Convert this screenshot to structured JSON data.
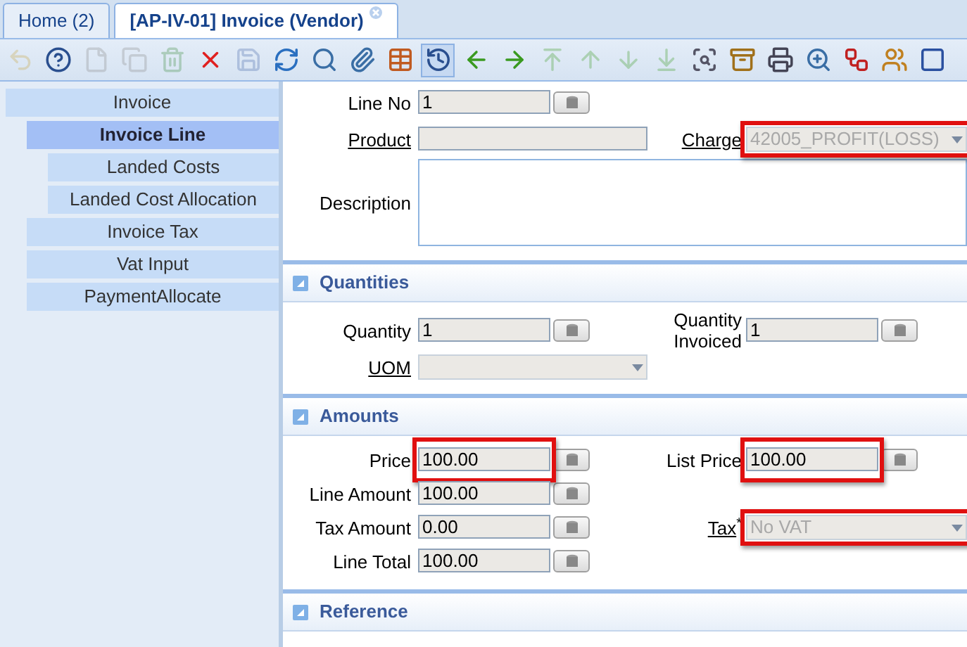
{
  "tabs": [
    {
      "label": "Home (2)",
      "selected": false,
      "closable": false
    },
    {
      "label": "[AP-IV-01] Invoice (Vendor)",
      "selected": true,
      "closable": true
    }
  ],
  "toolbar": [
    {
      "disabled": true,
      "pressed": false
    },
    {
      "disabled": false,
      "pressed": false
    },
    {
      "disabled": true,
      "pressed": false
    },
    {
      "disabled": true,
      "pressed": false
    },
    {
      "disabled": true,
      "pressed": false
    },
    {
      "disabled": false,
      "pressed": false
    },
    {
      "disabled": true,
      "pressed": false
    },
    {
      "disabled": false,
      "pressed": false
    },
    {
      "disabled": false,
      "pressed": false
    },
    {
      "disabled": false,
      "pressed": false
    },
    {
      "disabled": false,
      "pressed": false
    },
    {
      "disabled": false,
      "pressed": true
    },
    {
      "disabled": false,
      "pressed": false
    },
    {
      "disabled": false,
      "pressed": false
    },
    {
      "disabled": true,
      "pressed": false
    },
    {
      "disabled": true,
      "pressed": false
    },
    {
      "disabled": true,
      "pressed": false
    },
    {
      "disabled": true,
      "pressed": false
    },
    {
      "disabled": false,
      "pressed": false
    },
    {
      "disabled": false,
      "pressed": false
    },
    {
      "disabled": false,
      "pressed": false
    },
    {
      "disabled": false,
      "pressed": false
    },
    {
      "disabled": false,
      "pressed": false
    },
    {
      "disabled": false,
      "pressed": false
    },
    {
      "disabled": false,
      "pressed": false
    }
  ],
  "sidebar": {
    "items": [
      {
        "label": "Invoice",
        "selected": false,
        "children": [
          {
            "label": "Invoice Line",
            "selected": true,
            "children": [
              {
                "label": "Landed Costs",
                "selected": false
              },
              {
                "label": "Landed Cost Allocation",
                "selected": false
              }
            ]
          },
          {
            "label": "Invoice Tax",
            "selected": false
          },
          {
            "label": "Vat Input",
            "selected": false
          },
          {
            "label": "PaymentAllocate",
            "selected": false
          }
        ]
      }
    ]
  },
  "header_rows": [
    {
      "left": {
        "label": "Line No",
        "kind": "number",
        "value": "1",
        "link": false
      }
    },
    {
      "left": {
        "label": "Product",
        "kind": "text",
        "link": true
      },
      "right": {
        "label": "Charge",
        "kind": "combo",
        "value": "42005_PROFIT(LOSS)",
        "link": true,
        "highlighted": true,
        "dimmed": true
      }
    },
    {
      "full": {
        "label": "Description",
        "kind": "textarea",
        "link": false
      }
    }
  ],
  "sections": [
    {
      "title": "Quantities",
      "expanded": true,
      "rows": [
        {
          "left": {
            "label": "Quantity",
            "kind": "number",
            "value": "1",
            "link": false
          },
          "right": {
            "label": "Quantity Invoiced",
            "kind": "number",
            "value": "1",
            "link": false
          }
        },
        {
          "left": {
            "label": "UOM",
            "kind": "combo",
            "link": true
          }
        }
      ]
    },
    {
      "title": "Amounts",
      "expanded": true,
      "rows": [
        {
          "left": {
            "label": "Price",
            "kind": "number",
            "value": "100.00",
            "link": false,
            "highlighted": true
          },
          "right": {
            "label": "List Price",
            "kind": "number",
            "value": "100.00",
            "link": false,
            "highlighted": true
          }
        },
        {
          "left": {
            "label": "Line Amount",
            "kind": "number",
            "value": "100.00",
            "link": false
          }
        },
        {
          "left": {
            "label": "Tax Amount",
            "kind": "number",
            "value": "0.00",
            "link": false
          },
          "right": {
            "label": "Tax",
            "required_mark": "*",
            "kind": "combo",
            "value": "No VAT",
            "link": true,
            "highlighted": true,
            "dimmed": true
          }
        },
        {
          "left": {
            "label": "Line Total",
            "kind": "number",
            "value": "100.00",
            "link": false
          }
        }
      ]
    },
    {
      "title": "Reference",
      "expanded": true
    }
  ]
}
